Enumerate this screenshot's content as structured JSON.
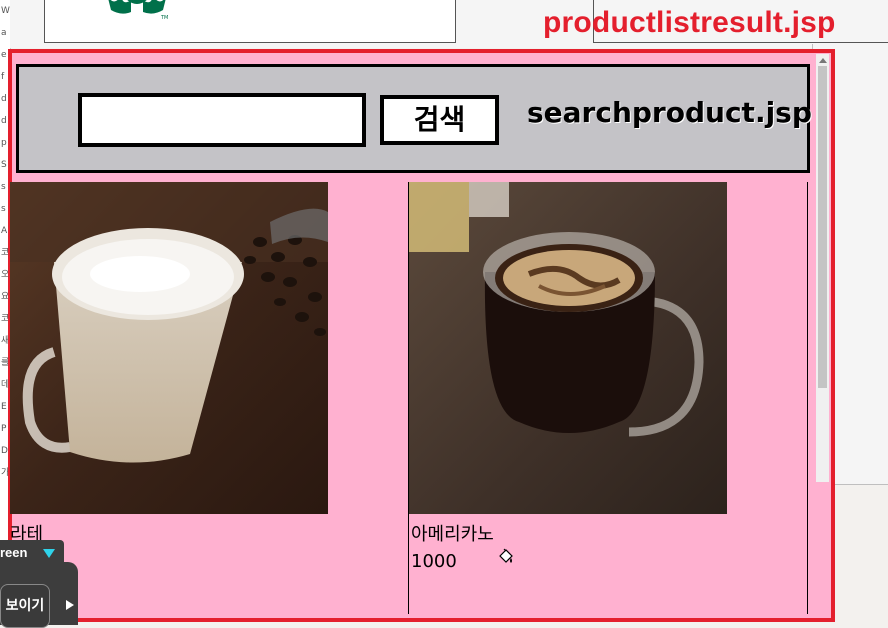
{
  "annotation": {
    "title": "productlistresult.jsp"
  },
  "search": {
    "value": "",
    "button_label": "검색",
    "panel_label": "searchproduct.jsp"
  },
  "products": [
    {
      "name": "라테",
      "price": ""
    },
    {
      "name": "아메리카노",
      "price": "1000"
    }
  ],
  "side_strip": [
    "W",
    "a",
    "e",
    "f",
    "d",
    "d",
    "p",
    "S",
    "s",
    "s",
    "A",
    "코",
    "오",
    "요",
    "코",
    "새",
    "를",
    "데",
    "E",
    "P",
    "D",
    "가"
  ],
  "overlay_tool": {
    "label": "reen",
    "button": "보이기"
  },
  "colors": {
    "annotation_red": "#e41f2d",
    "frame_pink": "#ffb1d0",
    "search_panel_gray": "#c4c3c7",
    "logo_green": "#00704a"
  },
  "icons": [
    "starbucks-logo-icon",
    "paint-bucket-cursor-icon",
    "dropdown-triangle-icon",
    "play-arrow-icon",
    "scroll-up-icon"
  ]
}
